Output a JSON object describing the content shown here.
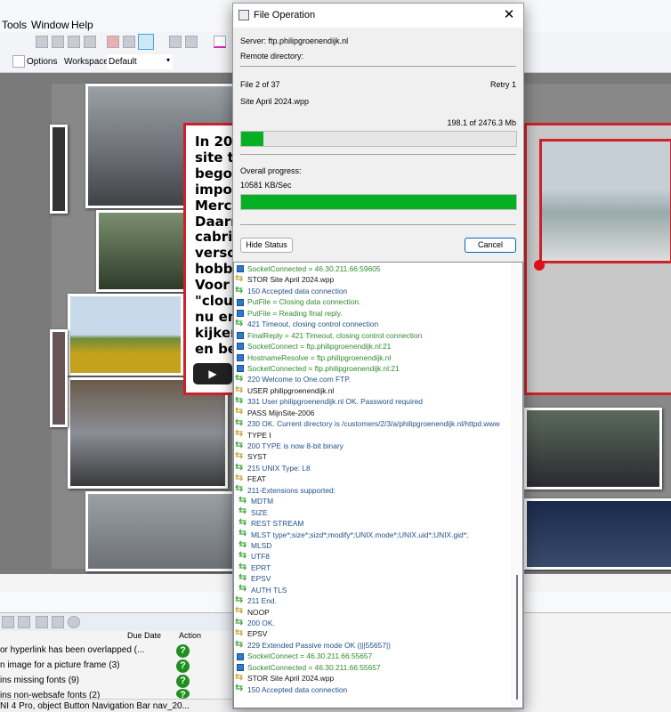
{
  "app": {
    "menu": [
      "Tools",
      "Window",
      "Help"
    ],
    "toolbar": {
      "options_label": "Options",
      "workspace_label": "Workspace",
      "workspace_value": "Default"
    },
    "document_text_lines": [
      "In 200",
      "site to",
      "begon",
      "impor",
      "Merce",
      "Daarn",
      "cabrio",
      "versch",
      "hobby",
      "Voor n",
      "\"cloud",
      "nu en",
      "kijken",
      "en bel"
    ],
    "issues_panel": {
      "columns": [
        "Due Date",
        "Action"
      ],
      "rows": [
        "or hyperlink has been overlapped (...",
        "n image for a picture frame (3)",
        "ins missing fonts (9)",
        "ins non-websafe fonts (2)"
      ]
    },
    "status_bar": "NI 4 Pro, object Button Navigation Bar nav_20..."
  },
  "dialog": {
    "title": "File Operation",
    "close_glyph": "✕",
    "server": "Server: ftp.philipgroenendijk.nl",
    "remote_directory": "Remote directory:",
    "file_counter": "File 2 of 37",
    "retry": "Retry 1",
    "file_name": "Site April 2024.wpp",
    "file_size_progress": "198.1 of 2476.3 Mb",
    "file_progress_fraction": 0.08,
    "overall_label": "Overall progress:",
    "speed": "10581 KB/Sec",
    "overall_progress_fraction": 1.0,
    "hide_status_label": "Hide Status",
    "cancel_label": "Cancel",
    "colors": {
      "progress": "#06b025",
      "info_text": "#2f8a2f",
      "response_text": "#1f4f8a"
    },
    "log": [
      {
        "type": "info",
        "text": "SocketConnected = 46.30.211.66:59605"
      },
      {
        "type": "cmd",
        "text": "STOR Site April 2024.wpp"
      },
      {
        "type": "resp",
        "text": "150 Accepted data connection"
      },
      {
        "type": "info",
        "text": "PutFile = Closing data connection."
      },
      {
        "type": "info",
        "text": "PutFile = Reading final reply."
      },
      {
        "type": "resp",
        "text": "421 Timeout, closing control connection"
      },
      {
        "type": "info",
        "text": "FinalReply = 421 Timeout, closing control connection"
      },
      {
        "type": "info",
        "text": "SocketConnect = ftp.philipgroenendijk.nl:21"
      },
      {
        "type": "info",
        "text": "HostnameResolve = ftp.philipgroenendijk.nl"
      },
      {
        "type": "info",
        "text": "SocketConnected = ftp.philipgroenendijk.nl:21"
      },
      {
        "type": "resp",
        "text": "220 Welcome to One.com FTP."
      },
      {
        "type": "cmd",
        "text": "USER philipgroenendijk.nl"
      },
      {
        "type": "resp",
        "text": "331 User philipgroenendijk.nl OK. Password required"
      },
      {
        "type": "cmd",
        "text": "PASS MijnSite-2006"
      },
      {
        "type": "resp",
        "text": "230 OK. Current directory is /customers/2/3/a/philipgroenendijk.nl/httpd.www"
      },
      {
        "type": "cmd",
        "text": "TYPE I"
      },
      {
        "type": "resp",
        "text": "200 TYPE is now 8-bit binary"
      },
      {
        "type": "cmd",
        "text": "SYST"
      },
      {
        "type": "resp",
        "text": "215 UNIX Type: L8"
      },
      {
        "type": "cmd",
        "text": "FEAT"
      },
      {
        "type": "resp",
        "text": "211-Extensions supported:"
      },
      {
        "type": "resp",
        "text": "MDTM",
        "indent": true
      },
      {
        "type": "resp",
        "text": "SIZE",
        "indent": true
      },
      {
        "type": "resp",
        "text": "REST STREAM",
        "indent": true
      },
      {
        "type": "resp",
        "text": "MLST type*;size*;sizd*;modify*;UNIX.mode*;UNIX.uid*;UNIX.gid*;",
        "indent": true
      },
      {
        "type": "resp",
        "text": "MLSD",
        "indent": true
      },
      {
        "type": "resp",
        "text": "UTF8",
        "indent": true
      },
      {
        "type": "resp",
        "text": "EPRT",
        "indent": true
      },
      {
        "type": "resp",
        "text": "EPSV",
        "indent": true
      },
      {
        "type": "resp",
        "text": "AUTH TLS",
        "indent": true
      },
      {
        "type": "resp",
        "text": "211 End."
      },
      {
        "type": "cmd",
        "text": "NOOP"
      },
      {
        "type": "resp",
        "text": "200 OK."
      },
      {
        "type": "cmd",
        "text": "EPSV"
      },
      {
        "type": "resp",
        "text": "229 Extended Passive mode OK (|||55657|)"
      },
      {
        "type": "info",
        "text": "SocketConnect = 46.30.211.66:55657"
      },
      {
        "type": "info",
        "text": "SocketConnected = 46.30.211.66:55657"
      },
      {
        "type": "cmd",
        "text": "STOR Site April 2024.wpp"
      },
      {
        "type": "resp",
        "text": "150 Accepted data connection"
      }
    ]
  }
}
